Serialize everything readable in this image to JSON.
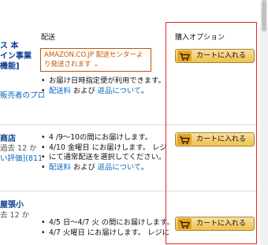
{
  "columns": {
    "delivery": "配送",
    "purchase": "購入オプション"
  },
  "offers": [
    {
      "seller_lines": [
        "ス 本",
        "イン事業",
        "機能]"
      ],
      "seller_link": "販売者のプロ",
      "ship_box": "AMAZON.CO.JP 配送センターより発送されます ⌄",
      "bullets": [
        {
          "text": "お届け日時指定便が利用できます。"
        },
        {
          "link1": "配送料",
          "mid": " および ",
          "link2": "返品について",
          "end": "。"
        }
      ],
      "cart_label": "カートに入れる"
    },
    {
      "seller_lines": [
        "商店",
        "過去 12 か",
        "い評価](811"
      ],
      "bullets": [
        {
          "text": "4 /9〜10の間にお届けします。"
        },
        {
          "text": "4/10 金曜日 にお届けします。 レジ"
        },
        {
          "text": "にて通常配送を選択してください。",
          "indent": true
        },
        {
          "link1": "配送料",
          "mid": " および ",
          "link2": "返品について",
          "end": "。"
        }
      ],
      "cart_label": "カートに入れる"
    },
    {
      "seller_lines": [
        "屋張小",
        "去 12 か"
      ],
      "bullets": [
        {
          "text": "4/5 日〜4/7 火 の間にお届けします。"
        },
        {
          "text": "4/7 火曜日 にお届けします。 レジに"
        }
      ],
      "cart_label": "カートに入れる"
    }
  ]
}
